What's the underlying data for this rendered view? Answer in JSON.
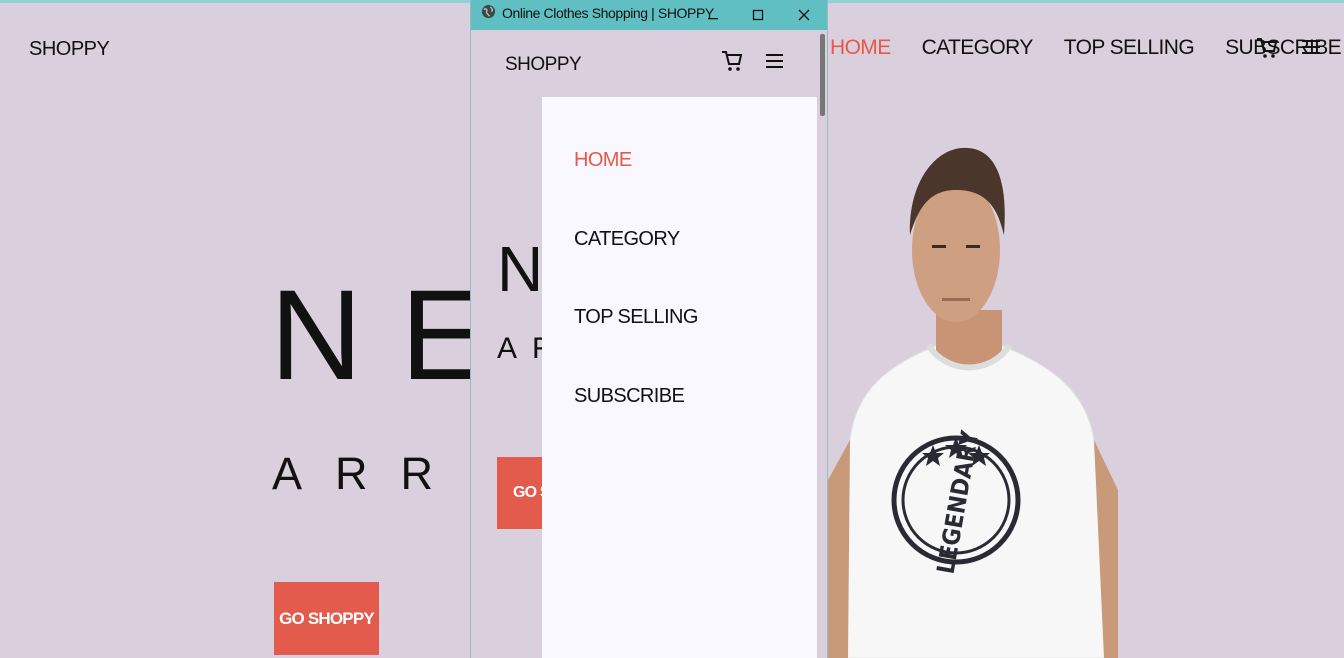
{
  "background_page": {
    "brand": "SHOPPY",
    "nav": [
      "HOME",
      "CATEGORY",
      "TOP SELLING",
      "SUBSCRIBE"
    ],
    "active_nav": "HOME",
    "hero_title": "NEW",
    "hero_subtitle": "ARRIV",
    "hero_button": "GO SHOPPY",
    "tshirt_text": "LEGENDARY",
    "icons": [
      "cart-icon",
      "hamburger-menu-icon"
    ]
  },
  "window": {
    "title": "Online Clothes Shopping | SHOPPY",
    "controls": [
      "minimize",
      "maximize",
      "close"
    ],
    "brand": "SHOPPY",
    "hero_title": "N",
    "hero_subtitle": "AR",
    "hero_button": "GO S",
    "drawer": {
      "items": [
        "HOME",
        "CATEGORY",
        "TOP SELLING",
        "SUBSCRIBE"
      ],
      "active": "HOME"
    }
  },
  "colors": {
    "page_bg": "#dacfdd",
    "accent": "#e25b4c",
    "active_link": "#e8584a",
    "titlebar": "#5fbfc3",
    "drawer_bg": "#f8f8fe"
  }
}
